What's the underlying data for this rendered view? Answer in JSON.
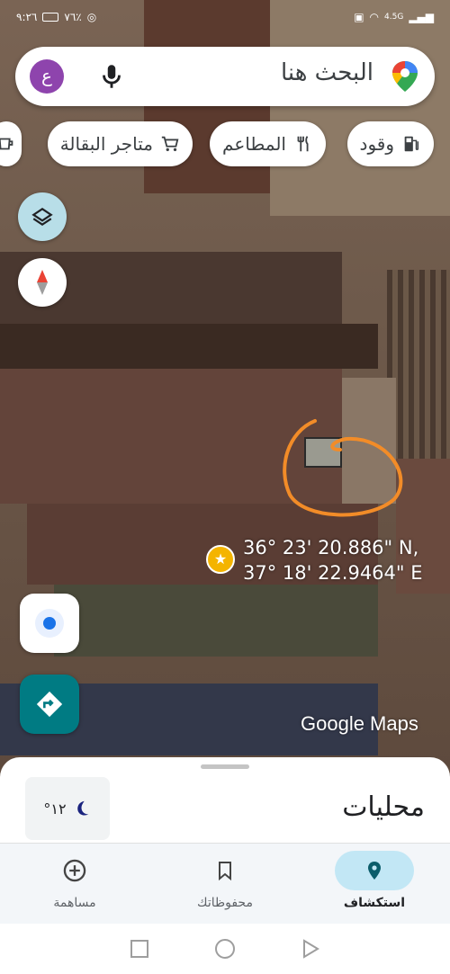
{
  "status_bar": {
    "time": "٩:٢٦",
    "battery": "٧٦٪",
    "network": "4.5G"
  },
  "search": {
    "placeholder": "البحث هنا",
    "avatar_letter": "ع",
    "pin_icon": "google-maps-pin-icon",
    "mic_icon": "mic-icon"
  },
  "chips": [
    {
      "label": "وقود",
      "icon": "gas-station-icon"
    },
    {
      "label": "المطاعم",
      "icon": "restaurant-icon"
    },
    {
      "label": "متاجر البقالة",
      "icon": "cart-icon"
    },
    {
      "label": "",
      "icon": "coffee-icon"
    }
  ],
  "map": {
    "coordinates_line1": "36° 23' 20.886\" N,",
    "coordinates_line2": "37° 18' 22.9464\" E",
    "watermark": "Google Maps",
    "annotation_color": "#f28c28"
  },
  "sheet": {
    "title": "محليات",
    "temperature": "°١٢",
    "weather_icon": "moon-icon"
  },
  "bottom_nav": [
    {
      "label": "استكشاف",
      "icon": "explore-pin-icon",
      "active": true
    },
    {
      "label": "محفوظاتك",
      "icon": "bookmark-icon",
      "active": false
    },
    {
      "label": "مساهمة",
      "icon": "add-circle-icon",
      "active": false
    }
  ],
  "colors": {
    "accent": "#007b83",
    "nav_active_bg": "#c2e7f5",
    "avatar": "#8e44ad",
    "star": "#f4b400"
  }
}
